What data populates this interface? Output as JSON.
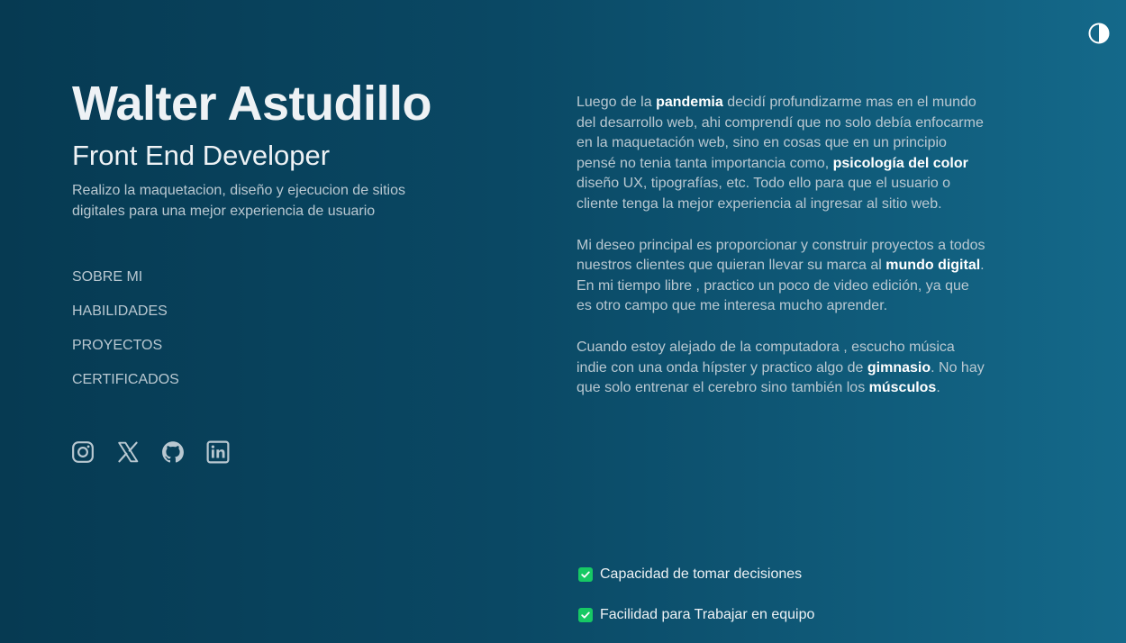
{
  "header": {
    "name": "Walter Astudillo",
    "role": "Front End Developer",
    "tagline": "Realizo la maquetacion, diseño y ejecucion de sitios digitales para una mejor experiencia de usuario"
  },
  "theme_toggle": {
    "icon": "contrast-icon"
  },
  "nav": {
    "items": [
      {
        "label": "SOBRE MI"
      },
      {
        "label": "HABILIDADES"
      },
      {
        "label": "PROYECTOS"
      },
      {
        "label": "CERTIFICADOS"
      }
    ]
  },
  "socials": [
    {
      "icon": "instagram-icon"
    },
    {
      "icon": "x-twitter-icon"
    },
    {
      "icon": "github-icon"
    },
    {
      "icon": "linkedin-icon"
    }
  ],
  "about": {
    "p1": {
      "t1": "Luego de la ",
      "b1": "pandemia",
      "t2": " decidí profundizarme mas en el mundo del desarrollo web, ahi comprendí que no solo debía enfocarme en la maquetación web, sino en cosas que en un principio pensé no tenia tanta importancia como, ",
      "b2": "psicología del color",
      "t3": " diseño UX, tipografías, etc. Todo ello para que el usuario o cliente tenga la mejor experiencia al ingresar al sitio web."
    },
    "p2": {
      "t1": "Mi deseo principal es proporcionar y construir proyectos a todos nuestros clientes que quieran llevar su marca al ",
      "b1": "mundo digital",
      "t2": ". En mi tiempo libre , practico un poco de video edición, ya que es otro campo que me interesa mucho aprender."
    },
    "p3": {
      "t1": "Cuando estoy alejado de la computadora , escucho música indie con una onda hípster y practico algo de ",
      "b1": "gimnasio",
      "t2": ". No hay que solo entrenar el cerebro sino también los ",
      "b2": "músculos",
      "t3": "."
    }
  },
  "skills": [
    {
      "label": "Capacidad de tomar decisiones",
      "checked": true
    },
    {
      "label": "Facilidad para Trabajar en equipo",
      "checked": true
    }
  ],
  "colors": {
    "background_start": "#063a52",
    "background_end": "#14698a",
    "accent_check": "#17c964",
    "muted_text": "#b9c8d1"
  }
}
